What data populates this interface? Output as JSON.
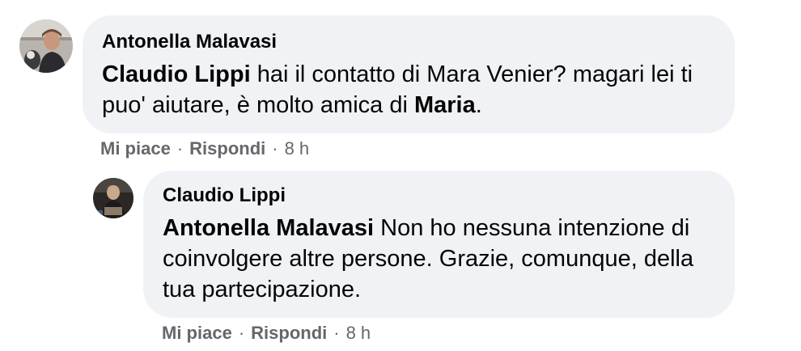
{
  "comments": [
    {
      "author": "Antonella Malavasi",
      "mention": "Claudio Lippi",
      "text_before": " hai il contatto di Mara Venier? magari lei ti puo' aiutare, è molto amica di ",
      "mention2": "Maria",
      "text_after": ".",
      "like_label": "Mi piace",
      "reply_label": "Rispondi",
      "time": "8 h",
      "separator": "·"
    },
    {
      "author": "Claudio Lippi",
      "mention": "Antonella Malavasi",
      "text": " Non ho nessuna intenzione di coinvolgere altre persone. Grazie, comunque, della tua partecipazione.",
      "like_label": "Mi piace",
      "reply_label": "Rispondi",
      "time": "8 h",
      "separator": "·"
    }
  ],
  "colors": {
    "bubble": "#f0f2f5",
    "text": "#050505",
    "secondary": "#65676b"
  }
}
